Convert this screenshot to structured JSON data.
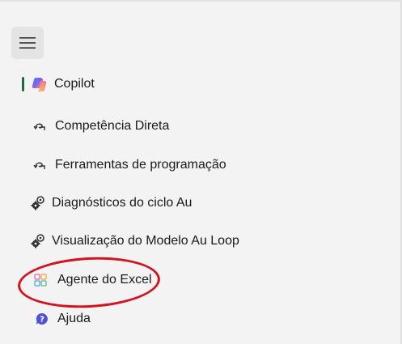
{
  "nav": {
    "menu_icon": "hamburger-menu-icon",
    "items": [
      {
        "label": "Copilot",
        "icon": "copilot-icon",
        "active": true
      },
      {
        "label": "Competência Direta",
        "icon": "arrow-loop-icon"
      },
      {
        "label": "Ferramentas de programação",
        "icon": "arrow-loop-icon"
      },
      {
        "label": "Diagnósticos do ciclo Au",
        "icon": "gears-icon"
      },
      {
        "label": "Visualização do Modelo Au Loop",
        "icon": "gears-icon"
      },
      {
        "label": "Agente do Excel",
        "icon": "excel-agent-icon",
        "highlighted": true
      },
      {
        "label": "Ajuda",
        "icon": "help-icon"
      }
    ]
  },
  "colors": {
    "background": "#f3f3f3",
    "active_indicator": "#1e6b3a",
    "annotation": "#d4111f",
    "help_icon": "#4f52d6"
  }
}
